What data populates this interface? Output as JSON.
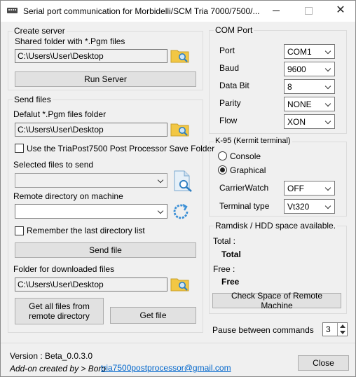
{
  "window": {
    "title": "Serial port communication for Morbidelli/SCM Tria 7000/7500/...",
    "minimize_icon": "minimize-icon",
    "maximize_icon": "maximize-icon",
    "close_glyph": "✕"
  },
  "create_server": {
    "title": "Create server",
    "shared_folder_label": "Shared folder with *.Pgm files",
    "shared_folder_path": "C:\\Users\\User\\Desktop",
    "run_server_label": "Run Server"
  },
  "send_files": {
    "title": "Send files",
    "default_folder_label": "Defalut *.Pgm files folder",
    "default_folder_path": "C:\\Users\\User\\Desktop",
    "use_post_processor_label": "Use the TriaPost7500 Post Processor Save Folder",
    "selected_files_label": "Selected files to send",
    "selected_files_value": "",
    "remote_dir_label": "Remote directory on machine",
    "remote_dir_value": "",
    "remember_dir_label": "Remember the last directory list",
    "send_file_label": "Send file",
    "download_folder_label": "Folder for downloaded files",
    "download_folder_path": "C:\\Users\\User\\Desktop",
    "get_all_label_line1": "Get all files from",
    "get_all_label_line2": "remote directory",
    "get_file_label": "Get file"
  },
  "com_port": {
    "title": "COM Port",
    "port_label": "Port",
    "port_value": "COM1",
    "baud_label": "Baud",
    "baud_value": "9600",
    "databit_label": "Data Bit",
    "databit_value": "8",
    "parity_label": "Parity",
    "parity_value": "NONE",
    "flow_label": "Flow",
    "flow_value": "XON"
  },
  "kermit": {
    "title": "K-95 (Kermit terminal)",
    "console_label": "Console",
    "graphical_label": "Graphical",
    "selected_mode": "Graphical",
    "carrierwatch_label": "CarrierWatch",
    "carrierwatch_value": "OFF",
    "terminal_type_label": "Terminal type",
    "terminal_type_value": "Vt320"
  },
  "ramdisk": {
    "title": "Ramdisk / HDD space available.",
    "total_label": "Total :",
    "total_value": "Total",
    "free_label": "Free :",
    "free_value": "Free",
    "check_space_label": "Check Space of Remote Machine"
  },
  "pause": {
    "label": "Pause between commands",
    "value": "3"
  },
  "footer": {
    "version": "Version : Beta_0.0.3.0",
    "credit": "Add-on created by > Boro",
    "email": "tria7500postprocessor@gmail.com",
    "close_label": "Close"
  },
  "colors": {
    "folder_yellow": "#f2c744",
    "magnifier_blue": "#2f7fc1",
    "refresh_blue": "#3a8fd6",
    "link_blue": "#0066cc"
  }
}
